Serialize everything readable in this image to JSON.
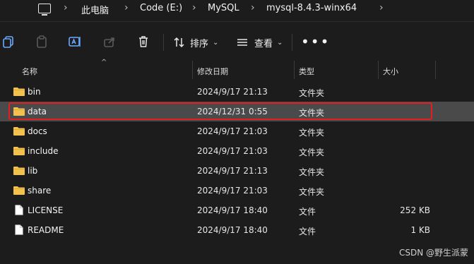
{
  "breadcrumb": [
    "此电脑",
    "Code (E:)",
    "MySQL",
    "mysql-8.4.3-winx64"
  ],
  "toolbar": {
    "sort_label": "排序",
    "view_label": "查看",
    "more_label": "•••"
  },
  "columns": {
    "name": "名称",
    "modified": "修改日期",
    "type": "类型",
    "size": "大小"
  },
  "files": [
    {
      "name": "bin",
      "modified": "2024/9/17 21:13",
      "type": "文件夹",
      "size": "",
      "kind": "folder"
    },
    {
      "name": "data",
      "modified": "2024/12/31 0:55",
      "type": "文件夹",
      "size": "",
      "kind": "folder",
      "selected": true
    },
    {
      "name": "docs",
      "modified": "2024/9/17 21:03",
      "type": "文件夹",
      "size": "",
      "kind": "folder"
    },
    {
      "name": "include",
      "modified": "2024/9/17 21:03",
      "type": "文件夹",
      "size": "",
      "kind": "folder"
    },
    {
      "name": "lib",
      "modified": "2024/9/17 21:13",
      "type": "文件夹",
      "size": "",
      "kind": "folder"
    },
    {
      "name": "share",
      "modified": "2024/9/17 21:03",
      "type": "文件夹",
      "size": "",
      "kind": "folder"
    },
    {
      "name": "LICENSE",
      "modified": "2024/9/17 18:40",
      "type": "文件",
      "size": "252 KB",
      "kind": "file"
    },
    {
      "name": "README",
      "modified": "2024/9/17 18:40",
      "type": "文件",
      "size": "1 KB",
      "kind": "file"
    }
  ],
  "watermark": "CSDN @野生派蒙",
  "colors": {
    "folder": "#f2c14e",
    "highlight": "#e02020",
    "selected_row": "#4a4a4a",
    "background": "#1c1c1c"
  }
}
